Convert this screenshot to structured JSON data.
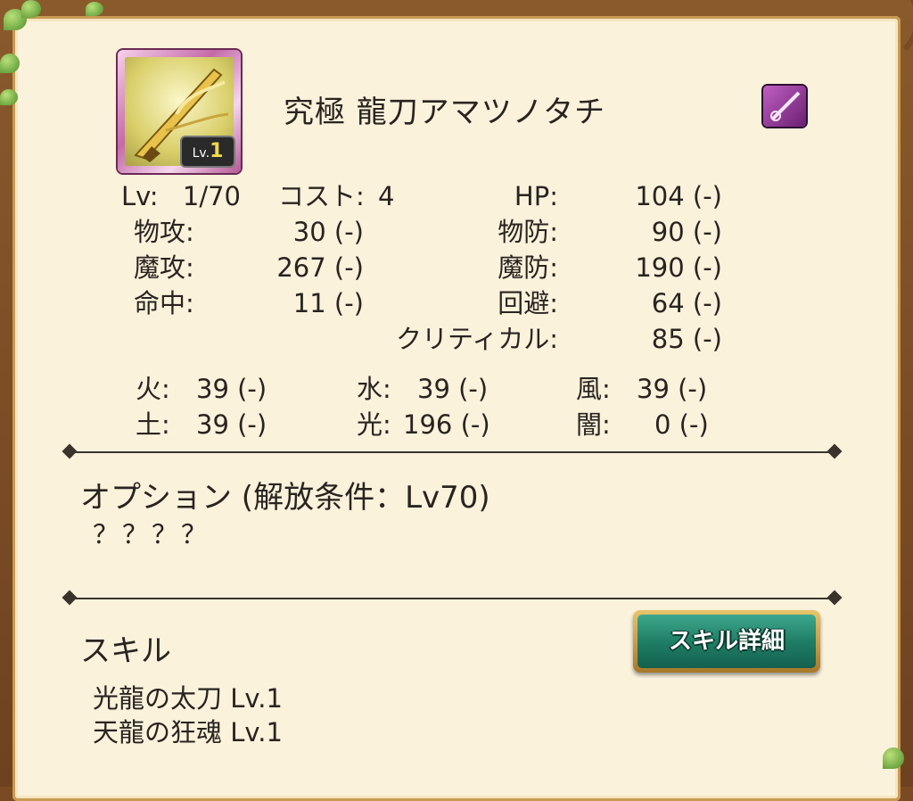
{
  "item": {
    "name": "究極 龍刀アマツノタチ",
    "icon": "katana-weapon-icon",
    "level_badge_prefix": "Lv.",
    "level_badge_value": "1",
    "type_icon": "sword-type-icon"
  },
  "stats": {
    "lv_label": "Lv:",
    "lv_value": "1/70",
    "cost_label": "コスト:",
    "cost_value": "4",
    "hp_label": "HP:",
    "hp_value": "104 (-)",
    "patk_label": "物攻:",
    "patk_value": "30 (-)",
    "pdef_label": "物防:",
    "pdef_value": "90 (-)",
    "matk_label": "魔攻:",
    "matk_value": "267 (-)",
    "mdef_label": "魔防:",
    "mdef_value": "190 (-)",
    "hit_label": "命中:",
    "hit_value": "11 (-)",
    "eva_label": "回避:",
    "eva_value": "64 (-)",
    "crit_label": "クリティカル:",
    "crit_value": "85 (-)"
  },
  "elements": {
    "fire_label": "火:",
    "fire_value": "39 (-)",
    "water_label": "水:",
    "water_value": "39 (-)",
    "wind_label": "風:",
    "wind_value": "39 (-)",
    "earth_label": "土:",
    "earth_value": "39 (-)",
    "light_label": "光:",
    "light_value": "196 (-)",
    "dark_label": "闇:",
    "dark_value": "0 (-)"
  },
  "option": {
    "title": "オプション (解放条件：Lv70)",
    "value": "？？？？"
  },
  "skills": {
    "title": "スキル",
    "button_label": "スキル詳細",
    "list": [
      "光龍の太刀 Lv.1",
      "天龍の狂魂 Lv.1"
    ]
  },
  "colors": {
    "panel": "#fbf2dc",
    "frame": "#7a4a22",
    "button": "#1f7f66",
    "icon_frame": "#c46aa8"
  }
}
